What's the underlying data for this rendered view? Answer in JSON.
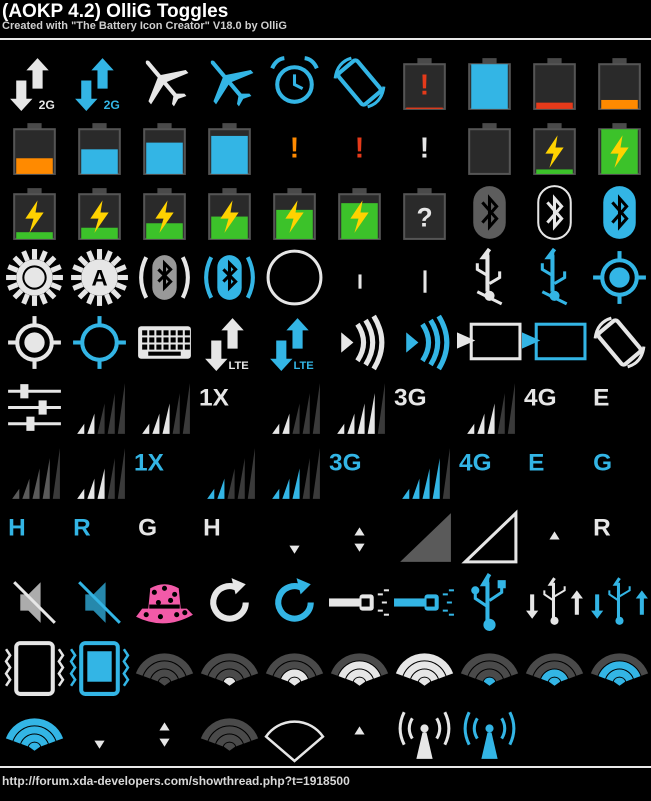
{
  "header": {
    "title": "(AOKP 4.2) OlliG Toggles",
    "subtitle": "Created with \"The Battery Icon Creator\" V18.0 by OlliG"
  },
  "footer": {
    "url": "http://forum.xda-developers.com/showthread.php?t=1918500"
  },
  "colors": {
    "blue": "#33b5e5",
    "white": "#e6e6e6",
    "grey": "#5a5a5a",
    "orange": "#ff8a00",
    "red": "#e53a1a",
    "green": "#3cc22a",
    "yellow": "#ffd200",
    "pink": "#f25aa8"
  },
  "icons": [
    {
      "name": "data-2g-white-icon",
      "kind": "data",
      "color": "white",
      "label": "2G"
    },
    {
      "name": "data-2g-blue-icon",
      "kind": "data",
      "color": "blue",
      "label": "2G"
    },
    {
      "name": "airplane-white-icon",
      "kind": "plane",
      "color": "white"
    },
    {
      "name": "airplane-blue-icon",
      "kind": "plane",
      "color": "blue"
    },
    {
      "name": "alarm-icon",
      "kind": "alarm",
      "color": "blue"
    },
    {
      "name": "rotation-icon",
      "kind": "rotate",
      "color": "blue"
    },
    {
      "name": "battery-alert-icon",
      "kind": "battery",
      "fill": 0.03,
      "color": "red",
      "mark": "!",
      "markColor": "red"
    },
    {
      "name": "battery-full-blue-icon",
      "kind": "battery",
      "fill": 1.0,
      "color": "blue"
    },
    {
      "name": "battery-low-red-icon",
      "kind": "battery",
      "fill": 0.14,
      "color": "red"
    },
    {
      "name": "battery-low-orange-icon",
      "kind": "battery",
      "fill": 0.2,
      "color": "orange"
    },
    {
      "name": "battery-orange-icon",
      "kind": "battery",
      "fill": 0.35,
      "color": "orange"
    },
    {
      "name": "battery-blue-half-icon",
      "kind": "battery",
      "fill": 0.55,
      "color": "blue"
    },
    {
      "name": "battery-blue-three-quarter-icon",
      "kind": "battery",
      "fill": 0.7,
      "color": "blue"
    },
    {
      "name": "battery-blue-high-icon",
      "kind": "battery",
      "fill": 0.85,
      "color": "blue"
    },
    {
      "name": "alert-orange-icon",
      "kind": "mark",
      "mark": "!",
      "markColor": "orange"
    },
    {
      "name": "alert-red-icon",
      "kind": "mark",
      "mark": "!",
      "markColor": "red"
    },
    {
      "name": "alert-white-icon",
      "kind": "mark",
      "mark": "!",
      "markColor": "white"
    },
    {
      "name": "battery-empty-icon",
      "kind": "battery",
      "fill": 0.0,
      "color": "grey"
    },
    {
      "name": "battery-charging-low-icon",
      "kind": "battery",
      "fill": 0.1,
      "color": "green",
      "bolt": true
    },
    {
      "name": "battery-charging-full-icon",
      "kind": "battery",
      "fill": 1.0,
      "color": "green",
      "bolt": true
    },
    {
      "name": "battery-charging-10-icon",
      "kind": "battery",
      "fill": 0.15,
      "color": "green",
      "bolt": true
    },
    {
      "name": "battery-charging-20-icon",
      "kind": "battery",
      "fill": 0.25,
      "color": "green",
      "bolt": true
    },
    {
      "name": "battery-charging-35-icon",
      "kind": "battery",
      "fill": 0.35,
      "color": "green",
      "bolt": true
    },
    {
      "name": "battery-charging-50-icon",
      "kind": "battery",
      "fill": 0.5,
      "color": "green",
      "bolt": true
    },
    {
      "name": "battery-charging-65-icon",
      "kind": "battery",
      "fill": 0.65,
      "color": "green",
      "bolt": true
    },
    {
      "name": "battery-charging-80-icon",
      "kind": "battery",
      "fill": 0.8,
      "color": "green",
      "bolt": true
    },
    {
      "name": "battery-unknown-icon",
      "kind": "battery",
      "fill": 0.0,
      "color": "grey",
      "mark": "?",
      "markColor": "white"
    },
    {
      "name": "bluetooth-grey-icon",
      "kind": "bt",
      "color": "grey"
    },
    {
      "name": "bluetooth-outline-icon",
      "kind": "bt",
      "color": "outline"
    },
    {
      "name": "bluetooth-blue-icon",
      "kind": "bt",
      "color": "blue"
    },
    {
      "name": "brightness-icon",
      "kind": "sun",
      "color": "white",
      "label": ""
    },
    {
      "name": "brightness-auto-icon",
      "kind": "sun",
      "color": "white",
      "label": "A"
    },
    {
      "name": "bluetooth-discoverable-white-icon",
      "kind": "btwaves",
      "color": "white"
    },
    {
      "name": "bluetooth-discoverable-blue-icon",
      "kind": "btwaves",
      "color": "blue"
    },
    {
      "name": "circle-outline-icon",
      "kind": "circle",
      "color": "white"
    },
    {
      "name": "small-bar-icon",
      "kind": "bar",
      "color": "white",
      "h": 14
    },
    {
      "name": "tall-bar-icon",
      "kind": "bar",
      "color": "white",
      "h": 22
    },
    {
      "name": "usb-tether-white-icon",
      "kind": "usbtether",
      "color": "white"
    },
    {
      "name": "usb-tether-blue-icon",
      "kind": "usbtether",
      "color": "blue"
    },
    {
      "name": "gps-on-icon",
      "kind": "gps",
      "color": "blue",
      "filled": true
    },
    {
      "name": "gps-white-icon",
      "kind": "gps",
      "color": "white",
      "filled": true
    },
    {
      "name": "gps-off-blue-icon",
      "kind": "gps",
      "color": "blue",
      "filled": false
    },
    {
      "name": "keyboard-icon",
      "kind": "keyboard",
      "color": "white"
    },
    {
      "name": "data-lte-white-icon",
      "kind": "data",
      "color": "white",
      "label": "LTE"
    },
    {
      "name": "data-lte-blue-icon",
      "kind": "data",
      "color": "blue",
      "label": "LTE"
    },
    {
      "name": "nfc-white-icon",
      "kind": "nfc",
      "color": "white"
    },
    {
      "name": "nfc-blue-icon",
      "kind": "nfc",
      "color": "blue"
    },
    {
      "name": "screencast-white-icon",
      "kind": "cast",
      "color": "white"
    },
    {
      "name": "screencast-blue-icon",
      "kind": "cast",
      "color": "blue"
    },
    {
      "name": "rotation-white-icon",
      "kind": "rotate",
      "color": "white"
    },
    {
      "name": "sliders-icon",
      "kind": "sliders",
      "color": "white"
    },
    {
      "name": "signal-2-bars-icon",
      "kind": "signal",
      "color": "white",
      "level": 2,
      "label": ""
    },
    {
      "name": "signal-3-bars-icon",
      "kind": "signal",
      "color": "white",
      "level": 3,
      "label": ""
    },
    {
      "name": "label-1x-white-icon",
      "kind": "text",
      "color": "white",
      "label": "1X"
    },
    {
      "name": "signal-2-bars-b-icon",
      "kind": "signal",
      "color": "white",
      "level": 2,
      "label": ""
    },
    {
      "name": "signal-4-bars-icon",
      "kind": "signal",
      "color": "white",
      "level": 4,
      "label": ""
    },
    {
      "name": "label-3g-white-icon",
      "kind": "text",
      "color": "white",
      "label": "3G"
    },
    {
      "name": "signal-3-bars-b-icon",
      "kind": "signal",
      "color": "white",
      "level": 3,
      "label": ""
    },
    {
      "name": "label-4g-white-icon",
      "kind": "text",
      "color": "white",
      "label": "4G"
    },
    {
      "name": "label-e-white-icon",
      "kind": "text",
      "color": "white",
      "label": "E"
    },
    {
      "name": "signal-dark-2-icon",
      "kind": "signal",
      "color": "grey",
      "level": 4,
      "label": ""
    },
    {
      "name": "signal-dark-3-icon",
      "kind": "signal",
      "color": "white",
      "level": 3,
      "label": ""
    },
    {
      "name": "label-1x-blue-icon",
      "kind": "text",
      "color": "blue",
      "label": "1X"
    },
    {
      "name": "signal-blue-2-icon",
      "kind": "signal",
      "color": "blue",
      "level": 2,
      "label": ""
    },
    {
      "name": "signal-blue-3-icon",
      "kind": "signal",
      "color": "blue",
      "level": 3,
      "label": ""
    },
    {
      "name": "label-3g-blue-icon",
      "kind": "text",
      "color": "blue",
      "label": "3G"
    },
    {
      "name": "signal-blue-4-icon",
      "kind": "signal",
      "color": "blue",
      "level": 4,
      "label": ""
    },
    {
      "name": "label-4g-blue-icon",
      "kind": "text",
      "color": "blue",
      "label": "4G"
    },
    {
      "name": "label-e-blue-icon",
      "kind": "text",
      "color": "blue",
      "label": "E"
    },
    {
      "name": "label-g-blue-icon",
      "kind": "text",
      "color": "blue",
      "label": "G"
    },
    {
      "name": "label-h-blue-icon",
      "kind": "text",
      "color": "blue",
      "label": "H"
    },
    {
      "name": "label-r-blue-icon",
      "kind": "text",
      "color": "blue",
      "label": "R"
    },
    {
      "name": "label-g-white-icon",
      "kind": "text",
      "color": "white",
      "label": "G"
    },
    {
      "name": "label-h-white-icon",
      "kind": "text",
      "color": "white",
      "label": "H"
    },
    {
      "name": "arrow-down-small-icon",
      "kind": "tri",
      "color": "white",
      "dir": "down"
    },
    {
      "name": "arrows-updown-icon",
      "kind": "updown",
      "color": "white"
    },
    {
      "name": "signal-triangle-filled-icon",
      "kind": "wedge",
      "color": "grey",
      "filled": true
    },
    {
      "name": "signal-triangle-outline-icon",
      "kind": "wedge",
      "color": "white",
      "filled": false
    },
    {
      "name": "arrow-up-small-icon",
      "kind": "tri",
      "color": "white",
      "dir": "up"
    },
    {
      "name": "label-r-white-icon",
      "kind": "text",
      "color": "white",
      "label": "R"
    },
    {
      "name": "sound-muted-white-icon",
      "kind": "mute",
      "color": "white"
    },
    {
      "name": "sound-muted-blue-icon",
      "kind": "mute",
      "color": "blue"
    },
    {
      "name": "pink-hat-icon",
      "kind": "hat",
      "color": "pink"
    },
    {
      "name": "sync-white-icon",
      "kind": "sync",
      "color": "white"
    },
    {
      "name": "sync-blue-icon",
      "kind": "sync",
      "color": "blue"
    },
    {
      "name": "flashlight-white-icon",
      "kind": "torch",
      "color": "white"
    },
    {
      "name": "flashlight-blue-icon",
      "kind": "torch",
      "color": "blue"
    },
    {
      "name": "usb-blue-icon",
      "kind": "usb",
      "color": "blue"
    },
    {
      "name": "usb-arrows-white-icon",
      "kind": "usbarrows",
      "color": "white"
    },
    {
      "name": "usb-arrows-blue-icon",
      "kind": "usbarrows",
      "color": "blue"
    },
    {
      "name": "vibrate-white-icon",
      "kind": "vibrate",
      "color": "white"
    },
    {
      "name": "vibrate-blue-icon",
      "kind": "vibrate",
      "color": "blue"
    },
    {
      "name": "wifi-0-icon",
      "kind": "wifi",
      "color": "white",
      "level": 0
    },
    {
      "name": "wifi-1-icon",
      "kind": "wifi",
      "color": "white",
      "level": 1
    },
    {
      "name": "wifi-2-icon",
      "kind": "wifi",
      "color": "white",
      "level": 2
    },
    {
      "name": "wifi-3-icon",
      "kind": "wifi",
      "color": "white",
      "level": 3
    },
    {
      "name": "wifi-4-icon",
      "kind": "wifi",
      "color": "white",
      "level": 4
    },
    {
      "name": "wifi-blue-1-icon",
      "kind": "wifi",
      "color": "blue",
      "level": 1
    },
    {
      "name": "wifi-blue-2-icon",
      "kind": "wifi",
      "color": "blue",
      "level": 2
    },
    {
      "name": "wifi-blue-3-icon",
      "kind": "wifi",
      "color": "blue",
      "level": 3
    },
    {
      "name": "wifi-blue-4-icon",
      "kind": "wifi",
      "color": "blue",
      "level": 4
    },
    {
      "name": "arrow-down-small-b-icon",
      "kind": "tri",
      "color": "white",
      "dir": "down"
    },
    {
      "name": "arrows-updown-b-icon",
      "kind": "updown",
      "color": "white"
    },
    {
      "name": "wifi-dark-icon",
      "kind": "wifi",
      "color": "white",
      "level": 0
    },
    {
      "name": "wifi-outline-icon",
      "kind": "wifioutline",
      "color": "white"
    },
    {
      "name": "arrow-up-small-b-icon",
      "kind": "tri",
      "color": "white",
      "dir": "up"
    },
    {
      "name": "wifi-ap-white-icon",
      "kind": "ap",
      "color": "white"
    },
    {
      "name": "wifi-ap-blue-icon",
      "kind": "ap",
      "color": "blue"
    }
  ]
}
